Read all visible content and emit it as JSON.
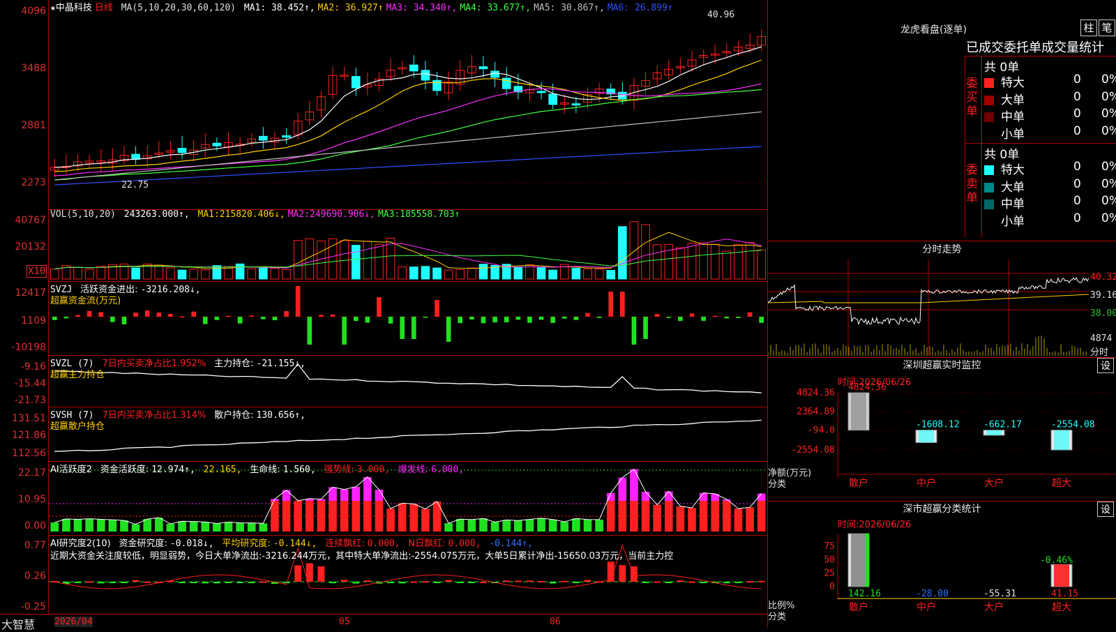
{
  "stock": {
    "star": "★",
    "name": "中晶科技",
    "period": "日线"
  },
  "main": {
    "ma_label": "MA(5,10,20,30,60,120)",
    "ma": [
      {
        "name": "MA1:",
        "value": "38.452↑,",
        "color": "#ffffff"
      },
      {
        "name": "MA2:",
        "value": "36.927↑",
        "color": "#ffd000"
      },
      {
        "name": "MA3:",
        "value": "34.340↑,",
        "color": "#ff30ff"
      },
      {
        "name": "MA4:",
        "value": "33.677↑,",
        "color": "#40ff40"
      },
      {
        "name": "MA5:",
        "value": "30.867↑,",
        "color": "#c0c0c0"
      },
      {
        "name": "MA6:",
        "value": "26.899↑",
        "color": "#3050ff"
      }
    ],
    "ticks": [
      "4096",
      "3488",
      "2881",
      "2273"
    ],
    "high_label": "40.96",
    "low_label": "22.75"
  },
  "vol": {
    "label": "VOL(5,10,20)",
    "value": "243263.000↑,",
    "ma": [
      {
        "name": "MA1:",
        "value": "215820.406↓,",
        "color": "#ffd000"
      },
      {
        "name": "MA2:",
        "value": "249690.906↓,",
        "color": "#ff30ff"
      },
      {
        "name": "MA3:",
        "value": "185558.703↑",
        "color": "#40ff40"
      }
    ],
    "ticks": [
      "40767",
      "20132"
    ],
    "unit": "X10"
  },
  "svzj": {
    "label": "SVZJ",
    "desc": "活跃资金进出:",
    "value": "-3216.208↓,",
    "sub": "超赢资金流(万元)",
    "ticks": [
      "12417",
      "1109",
      "-10198"
    ]
  },
  "svzl": {
    "label": "SVZL (7)",
    "desc": "7日内买卖净占比1.952%",
    "desc2": "主力持仓:",
    "value": "-21.155↓,",
    "sub": "超赢主力持仓",
    "ticks": [
      "-9.16",
      "-15.44",
      "-21.73"
    ]
  },
  "svsh": {
    "label": "SVSH (7)",
    "desc": "7日内买卖净占比1.314%",
    "desc2": "散户持仓:",
    "value": "130.656↑,",
    "sub": "超赢散户持仓",
    "ticks": [
      "131.51",
      "121.86",
      "112.56"
    ]
  },
  "ai1": {
    "label": "AI活跃度2",
    "desc": "资金活跃度:",
    "v1": "12.974↑,",
    "v2": "22.165,",
    "d3": "生命线:",
    "v3": "1.560,",
    "d4": "强势线:",
    "v4": "3.000,",
    "d5": "爆发线:",
    "v5": "6.000,",
    "ticks": [
      "22.17",
      "10.95",
      "0.00"
    ]
  },
  "ai2": {
    "label": "AI研究度2(10)",
    "d1": "资金研究度:",
    "v1": "-0.018↓,",
    "d2": "平均研究度:",
    "v2": "-0.144↓,",
    "d3": "连续飘红:",
    "v3": "0.000,",
    "d4": "N日飘红:",
    "v4": "0.000,",
    "v5": "-0.144↑,",
    "note": "近期大资金关注度较低，明显弱势，今日大单净流出:-3216.244万元，其中特大单净流出:-2554.075万元，大单5日累计净出-15650.03万元，当前主力控",
    "ticks": [
      "0.77",
      "0.26",
      "-0.25"
    ]
  },
  "footer": {
    "brand": "大智慧",
    "date": "2026/04",
    "m05": "05",
    "m06": "06"
  },
  "lhb": {
    "title": "龙虎看盘(逐单)",
    "btn1": "柱",
    "btn2": "笔",
    "header": "已成交委托单成交量统计",
    "buy": {
      "side": "委买单",
      "total": "共 0单",
      "rows": [
        {
          "name": "特大",
          "v": "0",
          "p": "0%",
          "color": "#ff2020"
        },
        {
          "name": "大单",
          "v": "0",
          "p": "0%",
          "color": "#a00000"
        },
        {
          "name": "中单",
          "v": "0",
          "p": "0%",
          "color": "#700000"
        },
        {
          "name": "小单",
          "v": "0",
          "p": "0%",
          "color": ""
        }
      ]
    },
    "sell": {
      "side": "委卖单",
      "total": "共 0单",
      "rows": [
        {
          "name": "特大",
          "v": "0",
          "p": "0%",
          "color": "#20ffff"
        },
        {
          "name": "大单",
          "v": "0",
          "p": "0%",
          "color": "#008888"
        },
        {
          "name": "中单",
          "v": "0",
          "p": "0%",
          "color": "#006868"
        },
        {
          "name": "小单",
          "v": "0",
          "p": "0%",
          "color": ""
        }
      ]
    }
  },
  "intraday": {
    "title": "分时走势",
    "ticks": [
      "40.32",
      "39.16",
      "38.00"
    ],
    "vol_tick": "4874",
    "vol_label": "分时"
  },
  "monitor": {
    "title": "深圳超赢实时监控",
    "btn": "设",
    "time_label": "时间:",
    "time": "2026/06/26",
    "ticks": [
      "4824.36",
      "2364.89",
      "-94.0",
      "-2554.08"
    ],
    "ylabel1": "净额(万元)",
    "ylabel2": "分类",
    "bars": [
      {
        "cat": "散户",
        "value": 4824.36,
        "label": "4824.36"
      },
      {
        "cat": "中户",
        "value": -1608.12,
        "label": "-1608.12"
      },
      {
        "cat": "大户",
        "value": -662.17,
        "label": "-662.17"
      },
      {
        "cat": "超大",
        "value": -2554.08,
        "label": "-2554.08"
      }
    ]
  },
  "classify": {
    "title": "深市超赢分类统计",
    "btn": "设",
    "time_label": "时间:",
    "time": "2026/06/26",
    "ticks": [
      "75",
      "50",
      "25",
      "0"
    ],
    "ylabel1": "比例%",
    "ylabel2": "分类",
    "top_label": "-0.46%",
    "bars": [
      {
        "cat": "散户",
        "value": 142.16,
        "label": "142.16"
      },
      {
        "cat": "中户",
        "value": -28.0,
        "label": "-28.00"
      },
      {
        "cat": "大户",
        "value": -55.31,
        "label": "-55.31"
      },
      {
        "cat": "超大",
        "value": 41.15,
        "label": "41.15"
      }
    ]
  },
  "colors": {
    "up": "#ff2020",
    "down": "#20ffff",
    "grid": "#b00000",
    "green": "#20e020",
    "magenta": "#ff20ff",
    "yellow": "#ffd000"
  }
}
